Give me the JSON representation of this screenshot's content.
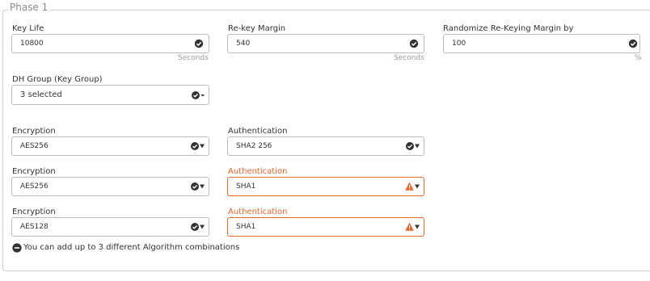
{
  "section": {
    "legend": "Phase 1"
  },
  "key_life": {
    "label": "Key Life",
    "value": "10800",
    "unit": "Seconds"
  },
  "rekey_margin": {
    "label": "Re-key Margin",
    "value": "540",
    "unit": "Seconds"
  },
  "randomize": {
    "label": "Randomize Re-Keying Margin by",
    "value": "100",
    "unit": "%"
  },
  "dh_group": {
    "label": "DH Group (Key Group)",
    "value": "3 selected"
  },
  "algorithms": [
    {
      "enc_label": "Encryption",
      "enc_value": "AES256",
      "auth_label": "Authentication",
      "auth_value": "SHA2 256",
      "auth_status": "ok"
    },
    {
      "enc_label": "Encryption",
      "enc_value": "AES256",
      "auth_label": "Authentication",
      "auth_value": "SHA1",
      "auth_status": "warning"
    },
    {
      "enc_label": "Encryption",
      "enc_value": "AES128",
      "auth_label": "Authentication",
      "auth_value": "SHA1",
      "auth_status": "warning"
    }
  ],
  "info": {
    "text": "You can add up to 3 different Algorithm combinations",
    "icon": "minus-circle-icon"
  },
  "colors": {
    "warning": "#e3672f",
    "border": "#bdbdbd",
    "muted": "#9a9a9a"
  }
}
